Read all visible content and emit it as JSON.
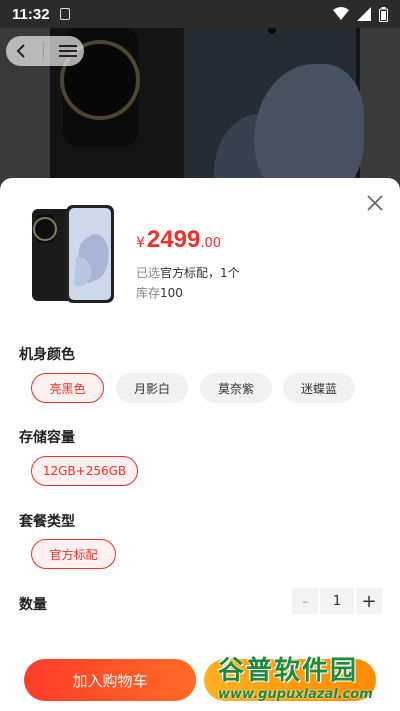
{
  "status_bar": {
    "time": "11:32"
  },
  "product": {
    "price_currency": "¥",
    "price_integer": "2499",
    "price_decimal": ".00",
    "selected_label": "已选",
    "selected_value": "官方标配，1个",
    "stock_label": "库存",
    "stock_value": "100"
  },
  "groups": {
    "color": {
      "title": "机身颜色",
      "options": [
        "亮黑色",
        "月影白",
        "莫奈紫",
        "迷蝶蓝"
      ],
      "selected": "亮黑色"
    },
    "storage": {
      "title": "存储容量",
      "options": [
        "12GB+256GB"
      ],
      "selected": "12GB+256GB"
    },
    "package": {
      "title": "套餐类型",
      "options": [
        "官方标配"
      ],
      "selected": "官方标配"
    }
  },
  "quantity": {
    "label": "数量",
    "value": "1",
    "minus": "-",
    "plus": "+"
  },
  "actions": {
    "add_to_cart": "加入购物车",
    "buy_now": ""
  },
  "watermark": {
    "brand": "谷普软件园",
    "url": "www.gupuxlazal.com"
  },
  "colors": {
    "accent": "#f0302a",
    "accent_bg": "#fff1f0",
    "buy": "#ff9a10"
  }
}
